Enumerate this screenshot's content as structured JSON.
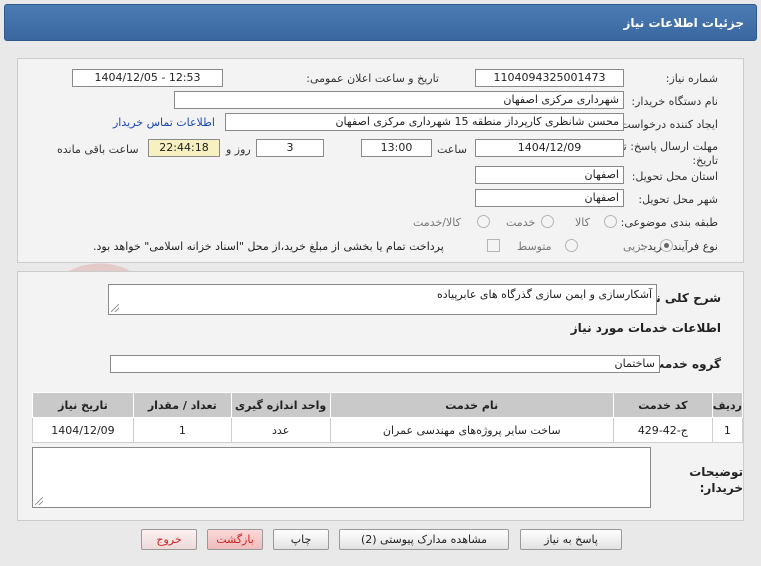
{
  "header": {
    "title": "جزئیات اطلاعات نیاز"
  },
  "form": {
    "need_number_label": "شماره نیاز:",
    "need_number": "1104094325001473",
    "announce_label": "تاریخ و ساعت اعلان عمومی:",
    "announce_value": "1404/12/05 - 12:53",
    "buyer_org_label": "نام دستگاه خریدار:",
    "buyer_org": "شهرداری مرکزی اصفهان",
    "creator_label": "ایجاد کننده درخواست:",
    "creator": "محسن شانظری کارپرداز منطقه 15 شهرداری مرکزی اصفهان",
    "contact_link": "اطلاعات تماس خریدار",
    "deadline_label_1": "مهلت ارسال پاسخ: تا",
    "deadline_label_2": "تاریخ:",
    "deadline_date": "1404/12/09",
    "time_label": "ساعت",
    "deadline_time": "13:00",
    "days_value": "3",
    "days_label": "روز و",
    "remaining_time": "22:44:18",
    "remaining_label": "ساعت باقی مانده",
    "province_label": "استان محل تحویل:",
    "province": "اصفهان",
    "city_label": "شهر محل تحویل:",
    "city": "اصفهان",
    "category_label": "طبقه بندی موضوعی:",
    "category_options": [
      "کالا",
      "خدمت",
      "کالا/خدمت"
    ],
    "process_label": "نوع فرآیند خرید :",
    "process_options": [
      "جزیی",
      "متوسط"
    ],
    "payment_note": "پرداخت تمام یا بخشی از مبلغ خرید،از محل \"اسناد خزانه اسلامی\" خواهد بود."
  },
  "details": {
    "summary_label": "شرح کلی نیاز:",
    "summary": "آشکارسازی و ایمن سازی گذرگاه های عابرپیاده",
    "services_title": "اطلاعات خدمات مورد نیاز",
    "group_label": "گروه خدمت:",
    "group_value": "ساختمان",
    "table": {
      "headers": [
        "ردیف",
        "کد خدمت",
        "نام خدمت",
        "واحد اندازه گیری",
        "تعداد / مقدار",
        "تاریخ نیاز"
      ],
      "rows": [
        [
          "1",
          "ج-42-429",
          "ساخت سایر پروژه‌های مهندسی عمران",
          "عدد",
          "1",
          "1404/12/09"
        ]
      ]
    },
    "buyer_notes_label_1": "توضیحات",
    "buyer_notes_label_2": "خریدار:"
  },
  "buttons": {
    "reply": "پاسخ به نیاز",
    "attachments": "مشاهده مدارک پیوستی (2)",
    "print": "چاپ",
    "back": "بازگشت",
    "exit": "خروج"
  },
  "watermark": {
    "text": "AriaTender.net"
  },
  "colors": {
    "header_bg": "#3f6ea8",
    "link": "#1a46b8",
    "accent_red": "#c22222"
  }
}
